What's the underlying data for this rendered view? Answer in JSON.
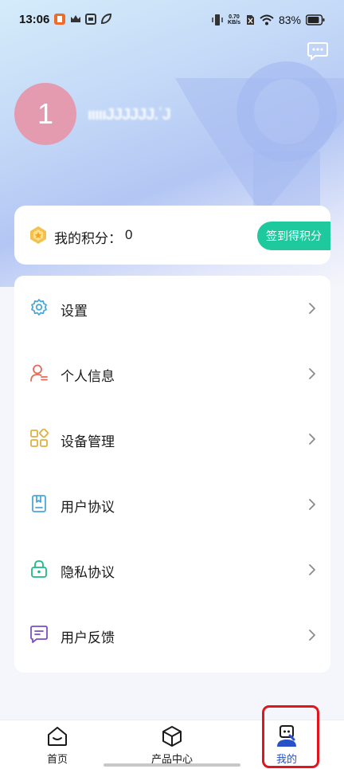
{
  "status_bar": {
    "time": "13:06",
    "net_speed_value": "0.70",
    "net_speed_unit": "KB/s",
    "battery": "83%",
    "icons": [
      "app-notification-icon",
      "crown-icon",
      "app-icon",
      "leaf-icon",
      "vibrate-icon",
      "sim-icon",
      "wifi-icon",
      "battery-icon"
    ]
  },
  "header": {
    "avatar_initial": "1",
    "username_masked": "ıııııJJJJJJ.ʿJ",
    "message_icon": "chat-bubble-icon"
  },
  "points": {
    "label": "我的积分：",
    "value": "0",
    "sign_button": "签到得积分",
    "icon": "points-badge-icon"
  },
  "menu": {
    "items": [
      {
        "label": "设置",
        "icon": "gear-icon",
        "color": "#4aa7d8"
      },
      {
        "label": "个人信息",
        "icon": "person-icon",
        "color": "#e46a5a"
      },
      {
        "label": "设备管理",
        "icon": "grid-icon",
        "color": "#e0b040"
      },
      {
        "label": "用户协议",
        "icon": "document-icon",
        "color": "#4aa7d8"
      },
      {
        "label": "隐私协议",
        "icon": "lock-icon",
        "color": "#21b88a"
      },
      {
        "label": "用户反馈",
        "icon": "feedback-icon",
        "color": "#7a4ec8"
      }
    ]
  },
  "bottom_nav": {
    "items": [
      {
        "label": "首页",
        "icon": "home-icon"
      },
      {
        "label": "产品中心",
        "icon": "cube-icon"
      },
      {
        "label": "我的",
        "icon": "profile-icon",
        "active": true
      }
    ]
  },
  "colors": {
    "accent_green": "#1fc99e",
    "active_blue": "#2850c8",
    "highlight_red": "#e2141c",
    "avatar_pink": "#e49bb0"
  }
}
